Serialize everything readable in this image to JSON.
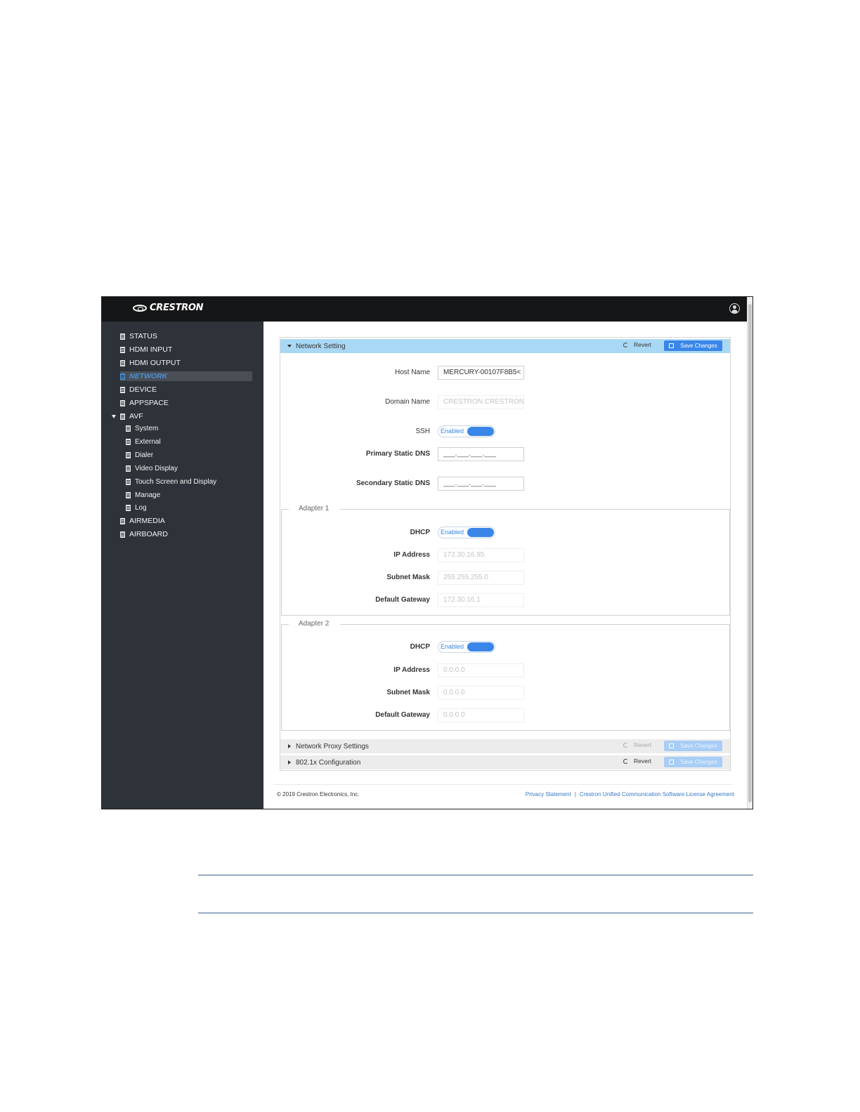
{
  "app": {
    "brand": "CRESTRON"
  },
  "sidebar": {
    "items": [
      {
        "label": "STATUS"
      },
      {
        "label": "HDMI INPUT"
      },
      {
        "label": "HDMI OUTPUT"
      },
      {
        "label": "NETWORK",
        "active": true
      },
      {
        "label": "DEVICE"
      },
      {
        "label": "APPSPACE"
      },
      {
        "label": "AVF",
        "expanded": true
      },
      {
        "label": "System"
      },
      {
        "label": "External"
      },
      {
        "label": "Dialer"
      },
      {
        "label": "Video Display"
      },
      {
        "label": "Touch Screen and Display"
      },
      {
        "label": "Manage"
      },
      {
        "label": "Log"
      },
      {
        "label": "AIRMEDIA"
      },
      {
        "label": "AIRBOARD"
      }
    ]
  },
  "network_setting": {
    "title": "Network Setting",
    "revert_label": "Revert",
    "save_label": "Save Changes",
    "host_name": {
      "label": "Host Name",
      "value": "MERCURY-00107F8B5<"
    },
    "domain_name": {
      "label": "Domain Name",
      "value": "CRESTRON.CRESTRON"
    },
    "ssh": {
      "label": "SSH",
      "state": "Enabled"
    },
    "primary_dns": {
      "label": "Primary Static DNS",
      "value": "___.___.___.___"
    },
    "secondary_dns": {
      "label": "Secondary Static DNS",
      "value": "___.___.___.___"
    }
  },
  "adapter1": {
    "title": "Adapter 1",
    "dhcp": {
      "label": "DHCP",
      "state": "Enabled"
    },
    "ip": {
      "label": "IP Address",
      "value": "172.30.16.95"
    },
    "subnet": {
      "label": "Subnet Mask",
      "value": "255.255.255.0"
    },
    "gateway": {
      "label": "Default Gateway",
      "value": "172.30.16.1"
    }
  },
  "adapter2": {
    "title": "Adapter 2",
    "dhcp": {
      "label": "DHCP",
      "state": "Enabled"
    },
    "ip": {
      "label": "IP Address",
      "value": "0.0.0.0"
    },
    "subnet": {
      "label": "Subnet Mask",
      "value": "0.0.0.0"
    },
    "gateway": {
      "label": "Default Gateway",
      "value": "0.0.0.0"
    }
  },
  "proxy": {
    "title": "Network Proxy Settings",
    "revert_label": "Revert",
    "save_label": "Save Changes"
  },
  "dot1x": {
    "title": "802.1x Configuration",
    "revert_label": "Revert",
    "save_label": "Save Changes"
  },
  "footer": {
    "copyright": "© 2019 Crestron Electronics, Inc.",
    "privacy_link": "Privacy Statement",
    "separator": "|",
    "license_link": "Crestron Unified Communication Software License Agreement"
  },
  "colors": {
    "accent": "#3a86e8",
    "section_header": "#a9d8f5",
    "sidebar_bg": "#2d3339",
    "topbar_bg": "#151617"
  }
}
